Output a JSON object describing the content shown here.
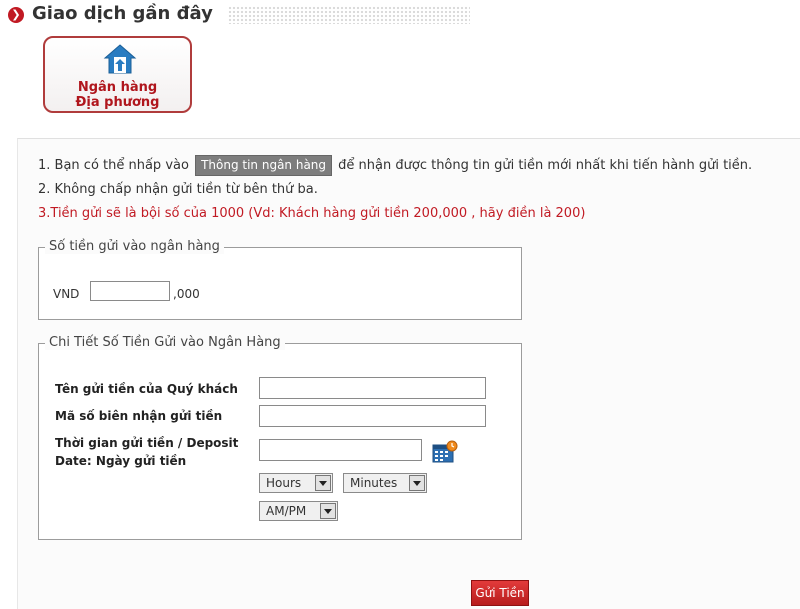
{
  "header": {
    "title": "Giao dịch gần đây",
    "bullet_icon": "red-arrow-bullet-icon"
  },
  "bank_tile": {
    "line1": "Ngân hàng",
    "line2": "Địa phương",
    "icon": "bank-house-icon",
    "accent": "#b0161d"
  },
  "notes": {
    "n1_prefix": "1. Bạn có thể nhấp vào",
    "n1_button": "Thông tin ngân hàng",
    "n1_suffix": "để nhận được thông tin gửi tiền mới nhất khi tiến hành gửi tiền.",
    "n2": "2. Không chấp nhận gửi tiền từ bên thứ ba.",
    "n3": "3.Tiền gửi sẽ là bội số của 1000 (Vd: Khách hàng gửi tiền 200,000 , hãy điền là 200)"
  },
  "amount_box": {
    "legend": "Số tiền gửi vào ngân hàng",
    "currency": "VND",
    "amount_value": "",
    "suffix": ",000"
  },
  "detail_box": {
    "legend": "Chi Tiết Số Tiền Gửi vào Ngân Hàng",
    "name_label": "Tên gửi tiền của Quý khách",
    "name_value": "",
    "receipt_label": "Mã số biên nhận gửi tiền",
    "receipt_value": "",
    "time_label_1": "Thời gian gửi tiền / Deposit",
    "time_label_2": "Date: Ngày gửi tiền",
    "date_value": "",
    "hours": "Hours",
    "minutes": "Minutes",
    "ampm": "AM/PM",
    "calendar_icon": "calendar-icon"
  },
  "submit": {
    "label": "Gửi Tiền"
  },
  "colors": {
    "brand_red": "#c11a23",
    "note_red": "#c11a23"
  }
}
